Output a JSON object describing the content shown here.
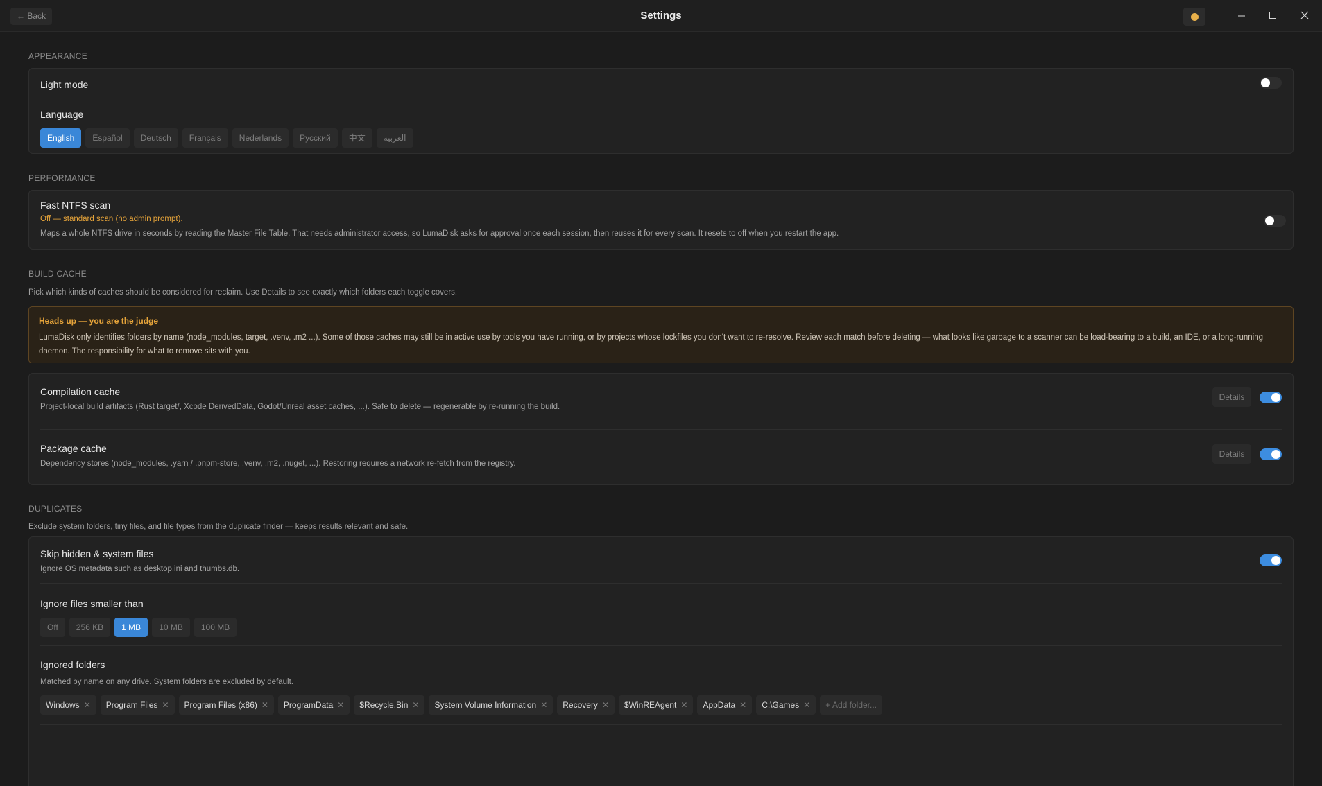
{
  "titlebar": {
    "back_label": "← Back",
    "title": "Settings",
    "theme_icon": "sun-icon",
    "accent_dot_color": "#e8b04a"
  },
  "appearance": {
    "section_title": "APPEARANCE",
    "light_mode_label": "Light mode",
    "light_mode_on": false,
    "language_label": "Language",
    "languages": [
      "English",
      "Español",
      "Deutsch",
      "Français",
      "Nederlands",
      "Русский",
      "中文",
      "العربية"
    ],
    "selected_language": "English"
  },
  "performance": {
    "section_title": "PERFORMANCE",
    "ntfs_label": "Fast NTFS scan",
    "ntfs_status": "Off — standard scan (no admin prompt).",
    "ntfs_status_color": "#e6a43a",
    "ntfs_description": "Maps a whole NTFS drive in seconds by reading the Master File Table. That needs administrator access, so LumaDisk asks for approval once each session, then reuses it for every scan. It resets to off when you restart the app.",
    "ntfs_on": false
  },
  "build_cache": {
    "section_title": "BUILD CACHE",
    "description": "Pick which kinds of caches should be considered for reclaim. Use Details to see exactly which folders each toggle covers.",
    "warning_title": "Heads up — you are the judge",
    "warning_body": "LumaDisk only identifies folders by name (node_modules, target, .venv, .m2 ...). Some of those caches may still be in active use by tools you have running, or by projects whose lockfiles you don't want to re-resolve. Review each match before deleting — what looks like garbage to a scanner can be load-bearing to a build, an IDE, or a long-running daemon. The responsibility for what to remove sits with you.",
    "items": [
      {
        "label": "Compilation cache",
        "description": "Project-local build artifacts (Rust target/, Xcode DerivedData, Godot/Unreal asset caches, ...). Safe to delete — regenerable by re-running the build.",
        "details_label": "Details",
        "on": true
      },
      {
        "label": "Package cache",
        "description": "Dependency stores (node_modules, .yarn / .pnpm-store, .venv, .m2, .nuget, ...). Restoring requires a network re-fetch from the registry.",
        "details_label": "Details",
        "on": true
      }
    ]
  },
  "duplicates": {
    "section_title": "DUPLICATES",
    "description": "Exclude system folders, tiny files, and file types from the duplicate finder — keeps results relevant and safe.",
    "skip_hidden_label": "Skip hidden & system files",
    "skip_hidden_description": "Ignore OS metadata such as desktop.ini and thumbs.db.",
    "skip_hidden_on": true,
    "min_size_label": "Ignore files smaller than",
    "size_options": [
      "Off",
      "256 KB",
      "1 MB",
      "10 MB",
      "100 MB"
    ],
    "selected_size": "1 MB",
    "ignored_folders_label": "Ignored folders",
    "ignored_folders_description": "Matched by name on any drive. System folders are excluded by default.",
    "ignored_folders": [
      "Windows",
      "Program Files",
      "Program Files (x86)",
      "ProgramData",
      "$Recycle.Bin",
      "System Volume Information",
      "Recovery",
      "$WinREAgent",
      "AppData",
      "C:\\Games"
    ],
    "add_folder_label": "+ Add folder..."
  },
  "accent_color": "#3a87d8"
}
